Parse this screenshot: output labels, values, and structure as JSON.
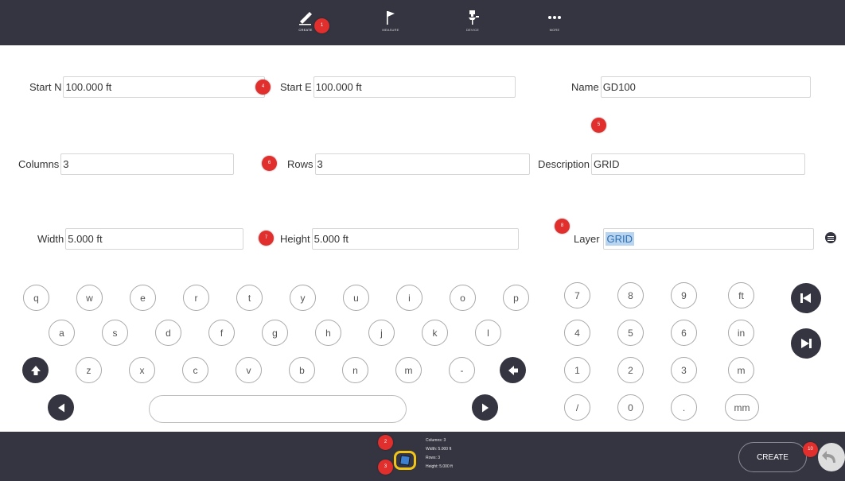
{
  "toolbar": {
    "items": [
      {
        "label": "CREATE",
        "icon": "pencil-icon",
        "active": true
      },
      {
        "label": "MEASURE",
        "icon": "flag-icon"
      },
      {
        "label": "DEVICE",
        "icon": "device-icon"
      },
      {
        "label": "MORE",
        "icon": "more-icon"
      }
    ]
  },
  "markers": [
    "1",
    "4",
    "5",
    "6",
    "7",
    "8",
    "2",
    "3",
    "10"
  ],
  "form": {
    "start_n": {
      "label": "Start N",
      "value": "100.000 ft"
    },
    "start_e": {
      "label": "Start E",
      "value": "100.000 ft"
    },
    "name": {
      "label": "Name",
      "value": "GD100"
    },
    "columns": {
      "label": "Columns",
      "value": "3"
    },
    "rows": {
      "label": "Rows",
      "value": "3"
    },
    "description": {
      "label": "Description",
      "value": "GRID"
    },
    "width": {
      "label": "Width",
      "value": "5.000 ft"
    },
    "height": {
      "label": "Height",
      "value": "5.000 ft"
    },
    "layer": {
      "label": "Layer",
      "value": "GRID"
    }
  },
  "keyboard": {
    "row1": [
      "q",
      "w",
      "e",
      "r",
      "t",
      "y",
      "u",
      "i",
      "o",
      "p"
    ],
    "row2": [
      "a",
      "s",
      "d",
      "f",
      "g",
      "h",
      "j",
      "k",
      "l"
    ],
    "row3": [
      "z",
      "x",
      "c",
      "v",
      "b",
      "n",
      "m",
      "-"
    ],
    "numpad": [
      [
        "7",
        "8",
        "9",
        "ft"
      ],
      [
        "4",
        "5",
        "6",
        "in"
      ],
      [
        "1",
        "2",
        "3",
        "m"
      ],
      [
        "/",
        "0",
        ".",
        "mm"
      ]
    ]
  },
  "summary": {
    "columns": "Columns: 3",
    "width": "Width: 5.000 ft",
    "rows": "Rows: 3",
    "height": "Height: 5.000 ft"
  },
  "create_label": "CREATE",
  "colors": {
    "bar": "#343541",
    "marker": "#e02f2c",
    "accent_yellow": "#f0c419",
    "selection": "#b9d4ee"
  }
}
